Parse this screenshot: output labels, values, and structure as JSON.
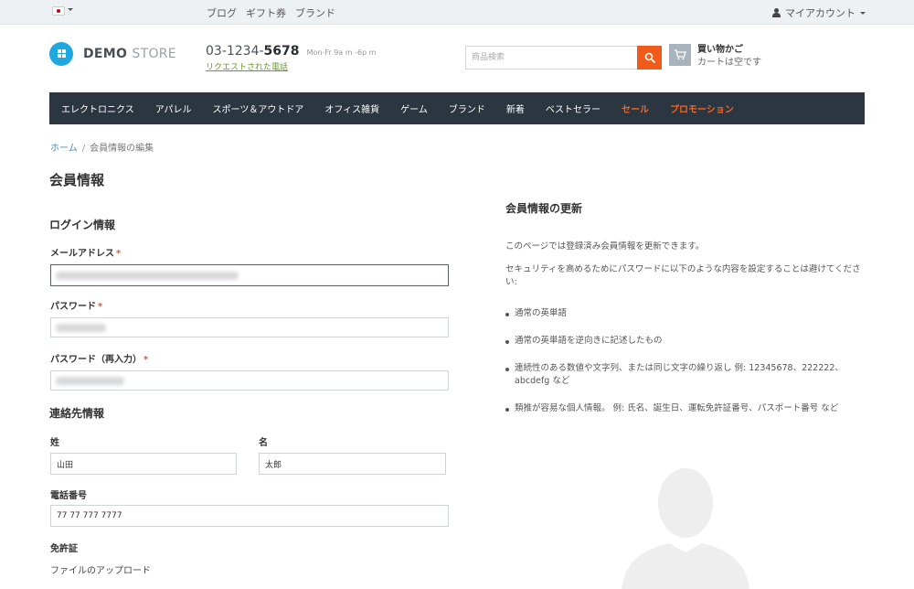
{
  "topbar": {
    "links": [
      "ブログ",
      "ギフト券",
      "ブランド"
    ],
    "account_label": "マイアカウント"
  },
  "header": {
    "logo_bold": "DEMO",
    "logo_light": "STORE",
    "phone_prefix": "03-1234-",
    "phone_bold": "5678",
    "phone_hours": "Mon-Fr 9a m -6p m",
    "callback_link": "リクエストされた電話",
    "search_placeholder": "商品検索",
    "cart_title": "買い物かご",
    "cart_status": "カートは空です",
    "accent_color": "#f05a1a"
  },
  "nav": {
    "items": [
      "エレクトロニクス",
      "アパレル",
      "スポーツ＆アウトドア",
      "オフィス雑貨",
      "ゲーム",
      "ブランド",
      "新着",
      "ベストセラー"
    ],
    "sale": "セール",
    "promotion": "プロモーション"
  },
  "breadcrumb": {
    "home": "ホーム",
    "separator": "/",
    "current": "会員情報の編集"
  },
  "page_title": "会員情報",
  "form": {
    "login_section": "ログイン情報",
    "email_label": "メールアドレス",
    "password_label": "パスワード",
    "password_confirm_label": "パスワード（再入力）",
    "required_mark": "*",
    "contact_section": "連絡先情報",
    "last_name_label": "姓",
    "last_name_value": "山田",
    "first_name_label": "名",
    "first_name_value": "太郎",
    "phone_label": "電話番号",
    "phone_value": "77 77 777 7777",
    "license_label": "免許証",
    "upload_link": "ファイルのアップロード"
  },
  "info": {
    "title": "会員情報の更新",
    "intro": "このページでは登録済み会員情報を更新できます。",
    "security_note": "セキュリティを高めるためにパスワードに以下のような内容を設定することは避けてください:",
    "tips": [
      "通常の英単語",
      "通常の英単語を逆向きに記述したもの",
      "連続性のある数値や文字列、または同じ文字の繰り返し 例: 12345678、222222、 abcdefg など",
      "類推が容易な個人情報。 例: 氏名、誕生日、運転免許証番号、パスポート番号 など"
    ]
  }
}
